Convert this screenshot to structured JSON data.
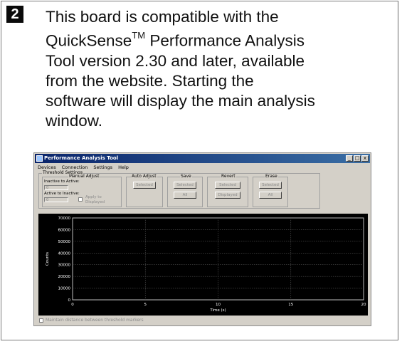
{
  "step": {
    "number": "2"
  },
  "intro": {
    "line_a": "This board is compatible with the",
    "line_b_pre": "QuickSense",
    "line_b_tm": "TM",
    "line_b_post": " Performance Analysis",
    "line_c": "Tool version 2.30 and later, available",
    "line_d": "from the website.  Starting the",
    "line_e": "software will display the main analysis",
    "line_f": "window."
  },
  "window": {
    "title": "Performance Analysis Tool",
    "controls": {
      "minimize": "_",
      "maximize": "□",
      "close": "x"
    },
    "menu": [
      "Devices",
      "Connection",
      "Settings",
      "Help"
    ],
    "threshold": {
      "title": "Threshold Settings",
      "manual": {
        "title": "Manual Adjust",
        "inactive_to_active_label": "Inactive to Active:",
        "inactive_to_active_value": "0",
        "active_to_inactive_label": "Active to Inactive:",
        "active_to_inactive_value": "0",
        "apply_label": "Apply to",
        "apply_label_2": "Displayed"
      },
      "auto_adjust": {
        "title": "Auto Adjust",
        "button": "Selected"
      },
      "save": {
        "title": "Save",
        "selected": "Selected",
        "all": "All"
      },
      "revert": {
        "title": "Revert",
        "selected": "Selected",
        "displayed": "Displayed"
      },
      "erase": {
        "title": "Erase",
        "selected": "Selected",
        "all": "All"
      }
    },
    "footer_checkbox_label": "Maintain distance between threshold markers"
  },
  "chart_data": {
    "type": "line",
    "title": "",
    "xlabel": "Time (s)",
    "ylabel": "Counts",
    "xlim": [
      0,
      20
    ],
    "ylim": [
      0,
      70000
    ],
    "x_ticks": [
      0,
      5,
      10,
      15,
      20
    ],
    "y_ticks": [
      0,
      10000,
      20000,
      30000,
      40000,
      50000,
      60000,
      70000
    ],
    "grid": true,
    "series": [],
    "colors": {
      "background": "#000000",
      "grid": "#555555",
      "text": "#ffffff"
    }
  }
}
